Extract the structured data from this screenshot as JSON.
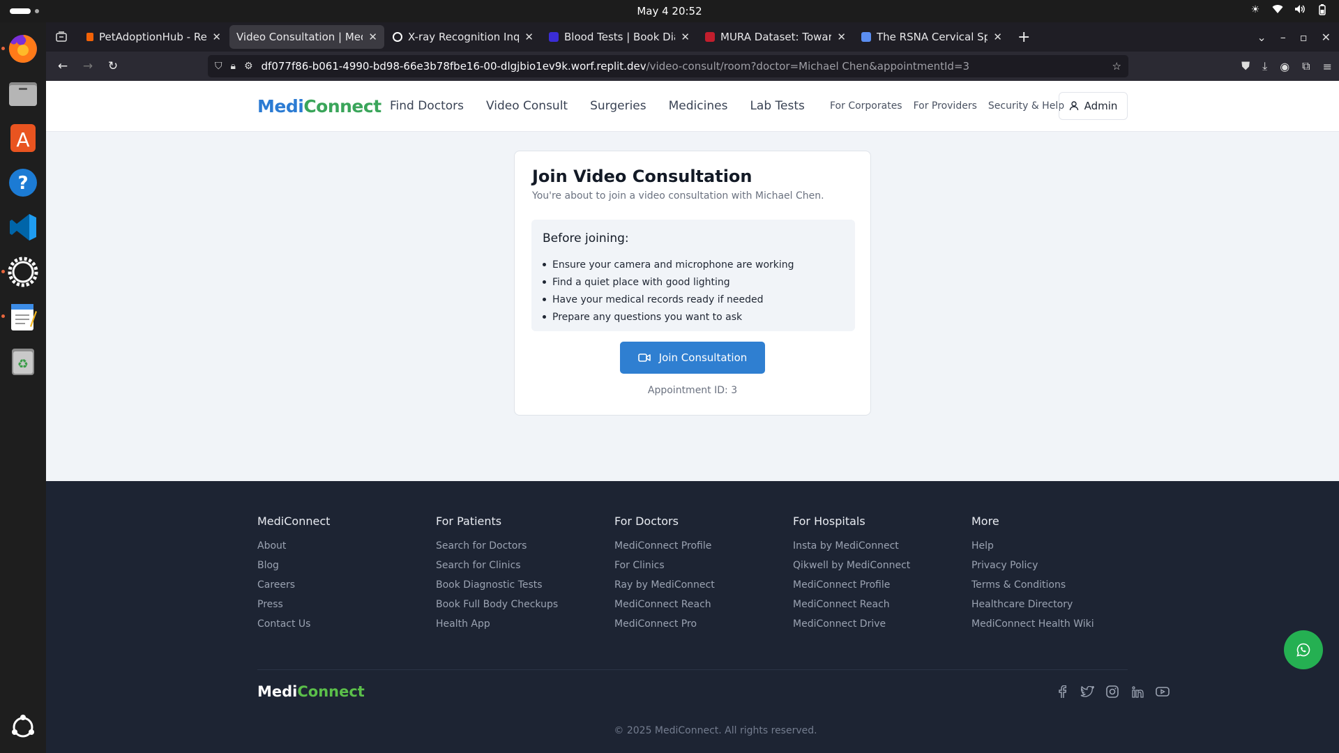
{
  "system": {
    "datetime": "May 4  20:52"
  },
  "browser": {
    "tabs": [
      {
        "title": "PetAdoptionHub - Replit",
        "favicon_color": "#f26207"
      },
      {
        "title": "Video Consultation | MediCo",
        "favicon_color": "#ffffff"
      },
      {
        "title": "X-ray Recognition Inquiry",
        "favicon_color": "#ffffff"
      },
      {
        "title": "Blood Tests | Book Diagnc",
        "favicon_color": "#3b2dd6"
      },
      {
        "title": "MURA Dataset: Towards F",
        "favicon_color": "#c21e2d"
      },
      {
        "title": "The RSNA Cervical Spine F",
        "favicon_color": "#5b8ef1"
      }
    ],
    "url_host": "df077f86-b061-4990-bd98-66e3b78fbe16-00-dlgjbio1ev9k.worf.replit.dev",
    "url_path": "/video-consult/room?doctor=Michael Chen&appointmentId=3"
  },
  "site": {
    "logo_medi": "Medi",
    "logo_connect": "Connect",
    "nav": [
      "Find Doctors",
      "Video Consult",
      "Surgeries",
      "Medicines",
      "Lab Tests"
    ],
    "secondary_nav": [
      "For Corporates",
      "For Providers",
      "Security & Help"
    ],
    "admin_label": "Admin"
  },
  "consult": {
    "title": "Join Video Consultation",
    "subtitle": "You're about to join a video consultation with Michael Chen.",
    "before_title": "Before joining:",
    "checklist": [
      "Ensure your camera and microphone are working",
      "Find a quiet place with good lighting",
      "Have your medical records ready if needed",
      "Prepare any questions you want to ask"
    ],
    "join_label": "Join Consultation",
    "appointment_text": "Appointment ID: 3"
  },
  "footer": {
    "columns": [
      {
        "heading": "MediConnect",
        "links": [
          "About",
          "Blog",
          "Careers",
          "Press",
          "Contact Us"
        ]
      },
      {
        "heading": "For Patients",
        "links": [
          "Search for Doctors",
          "Search for Clinics",
          "Book Diagnostic Tests",
          "Book Full Body Checkups",
          "Health App"
        ]
      },
      {
        "heading": "For Doctors",
        "links": [
          "MediConnect Profile",
          "For Clinics",
          "Ray by MediConnect",
          "MediConnect Reach",
          "MediConnect Pro"
        ]
      },
      {
        "heading": "For Hospitals",
        "links": [
          "Insta by MediConnect",
          "Qikwell by MediConnect",
          "MediConnect Profile",
          "MediConnect Reach",
          "MediConnect Drive"
        ]
      },
      {
        "heading": "More",
        "links": [
          "Help",
          "Privacy Policy",
          "Terms & Conditions",
          "Healthcare Directory",
          "MediConnect Health Wiki"
        ]
      }
    ],
    "logo_medi": "Medi",
    "logo_connect": "Connect",
    "copyright": "© 2025 MediConnect. All rights reserved."
  },
  "colors": {
    "primary_blue": "#2f7fd1",
    "logo_green": "#3aa55a",
    "footer_bg": "#1d2433",
    "whatsapp_green": "#25b052"
  }
}
